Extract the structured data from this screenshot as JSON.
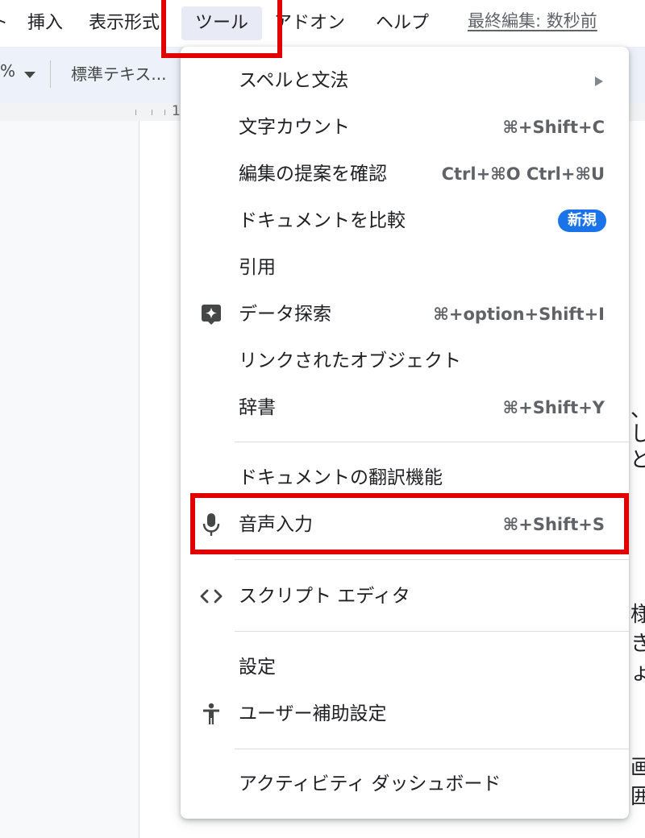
{
  "menubar": {
    "partial_left": "ト",
    "insert": "挿入",
    "format": "表示形式",
    "tools": "ツール",
    "addons": "アドオン",
    "help": "ヘルプ",
    "last_edit": "最終編集: 数秒前"
  },
  "toolbar": {
    "zoom_symbol": "%",
    "style_dropdown": "標準テキス..."
  },
  "ruler": {
    "label": "1"
  },
  "document_fragments": [
    "、",
    "し",
    "ど",
    "様",
    "き",
    "ょ",
    "画",
    "囲"
  ],
  "tools_menu": {
    "items": [
      {
        "label": "スペルと文法"
      },
      {
        "label": "文字カウント",
        "shortcut": "⌘+Shift+C"
      },
      {
        "label": "編集の提案を確認",
        "shortcut": "Ctrl+⌘O Ctrl+⌘U"
      },
      {
        "label": "ドキュメントを比較",
        "badge": "新規"
      },
      {
        "label": "引用"
      },
      {
        "label": "データ探索",
        "shortcut": "⌘+option+Shift+I",
        "icon": "explore-sparkle-icon"
      },
      {
        "label": "リンクされたオブジェクト"
      },
      {
        "label": "辞書",
        "shortcut": "⌘+Shift+Y"
      },
      {
        "label": "ドキュメントの翻訳機能"
      },
      {
        "label": "音声入力",
        "shortcut": "⌘+Shift+S",
        "icon": "microphone-icon"
      },
      {
        "label": "スクリプト エディタ",
        "icon": "code-brackets-icon"
      },
      {
        "label": "設定"
      },
      {
        "label": "ユーザー補助設定",
        "icon": "accessibility-icon"
      },
      {
        "label": "アクティビティ ダッシュボード"
      }
    ]
  },
  "colors": {
    "highlight": "#e00000",
    "badge": "#1a73e8",
    "toolbar_bg": "#edf2fa"
  }
}
